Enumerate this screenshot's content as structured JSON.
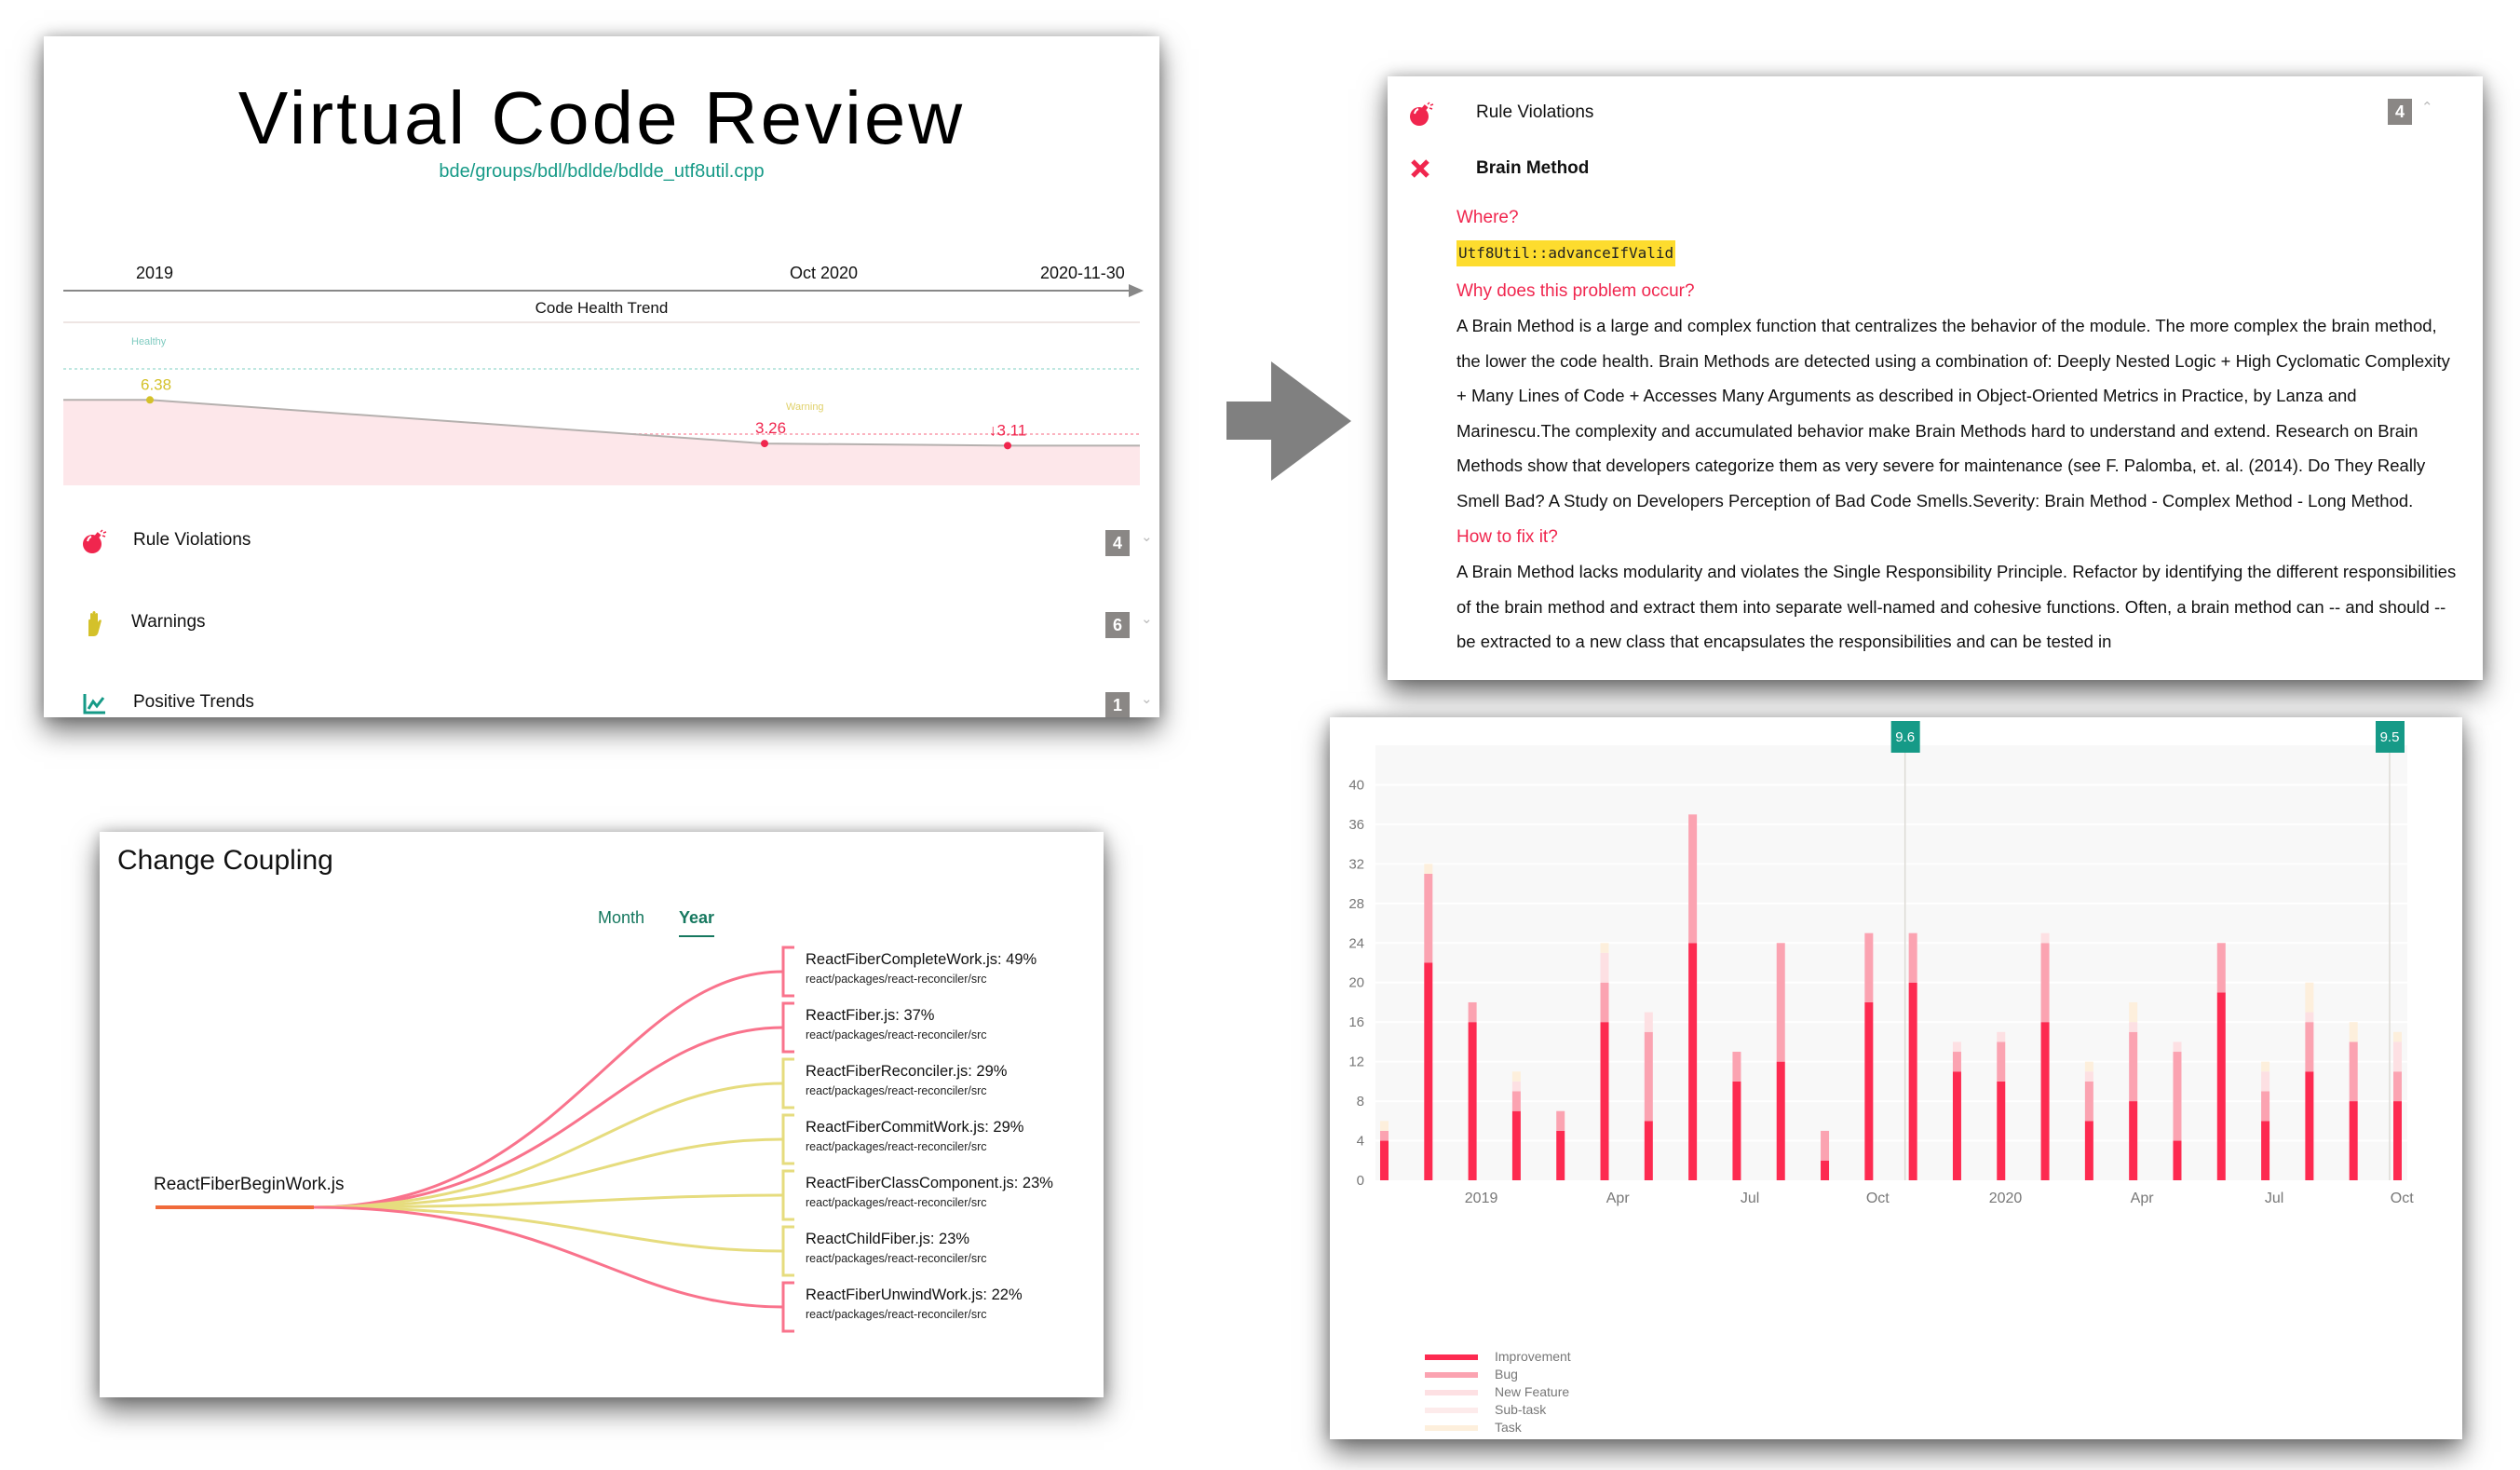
{
  "review": {
    "title": "Virtual Code Review",
    "file_path": "bde/groups/bdl/bdlde/bdlde_utf8util.cpp",
    "timeline_labels": [
      "2019",
      "Oct 2020",
      "2020-11-30"
    ],
    "health_chart": {
      "title": "Code Health Trend",
      "healthy_label": "Healthy",
      "warning_label": "Warning",
      "points": [
        {
          "label": "6.38",
          "value": 6.38,
          "status": "warning",
          "color": "#d4c12a"
        },
        {
          "label": "3.26",
          "value": 3.26,
          "status": "alert",
          "color": "#f0264e"
        },
        {
          "label": "↓3.11",
          "value": 3.11,
          "status": "alert",
          "color": "#f0264e"
        }
      ]
    },
    "issues": [
      {
        "label": "Rule Violations",
        "count": "4",
        "icon": "bomb-icon"
      },
      {
        "label": "Warnings",
        "count": "6",
        "icon": "hand-icon"
      },
      {
        "label": "Positive Trends",
        "count": "1",
        "icon": "trend-chart-icon"
      }
    ],
    "expand_glyph": "⌄"
  },
  "detail": {
    "header_label": "Rule Violations",
    "header_count": "4",
    "collapse_glyph": "⌃",
    "rule_name": "Brain Method",
    "where_heading": "Where?",
    "where_code": "Utf8Util::advanceIfValid",
    "why_heading": "Why does this problem occur?",
    "why_text": "A Brain Method is a large and complex function that centralizes the behavior of the module. The more complex the brain method, the lower the code health. Brain Methods are detected using a combination of: Deeply Nested Logic + High Cyclomatic Complexity + Many Lines of Code + Accesses Many Arguments as described in Object-Oriented Metrics in Practice, by Lanza and Marinescu.The complexity and accumulated behavior make Brain Methods hard to understand and extend. Research on Brain Methods show that developers categorize them as very severe for maintenance (see F. Palomba, et. al. (2014). Do They Really Smell Bad? A Study on Developers Perception of Bad Code Smells.Severity: Brain Method - Complex Method - Long Method.",
    "fix_heading": "How to fix it?",
    "fix_text": "A Brain Method lacks modularity and violates the Single Responsibility Principle. Refactor by identifying the different responsibilities of the brain method and extract them into separate well-named and cohesive functions. Often, a brain method can -- and should -- be extracted to a new class that encapsulates the responsibilities and can be tested in"
  },
  "coupling": {
    "title": "Change Coupling",
    "tabs": [
      {
        "label": "Month",
        "active": false
      },
      {
        "label": "Year",
        "active": true
      }
    ],
    "root": "ReactFiberBeginWork.js",
    "colors": {
      "high": "#f9738c",
      "medium": "#e6dc7e",
      "root": "#f06a3a"
    },
    "targets": [
      {
        "name": "ReactFiberCompleteWork.js: 49%",
        "path": "react/packages/react-reconciler/src",
        "level": "high"
      },
      {
        "name": "ReactFiber.js: 37%",
        "path": "react/packages/react-reconciler/src",
        "level": "high"
      },
      {
        "name": "ReactFiberReconciler.js: 29%",
        "path": "react/packages/react-reconciler/src",
        "level": "medium"
      },
      {
        "name": "ReactFiberCommitWork.js: 29%",
        "path": "react/packages/react-reconciler/src",
        "level": "medium"
      },
      {
        "name": "ReactFiberClassComponent.js: 23%",
        "path": "react/packages/react-reconciler/src",
        "level": "medium"
      },
      {
        "name": "ReactChildFiber.js: 23%",
        "path": "react/packages/react-reconciler/src",
        "level": "medium"
      },
      {
        "name": "ReactFiberUnwindWork.js: 22%",
        "path": "react/packages/react-reconciler/src",
        "level": "high"
      }
    ]
  },
  "chart_data": {
    "type": "bar",
    "stacked": true,
    "title": "",
    "xlabel": "",
    "ylabel": "",
    "ylim": [
      0,
      44
    ],
    "yticks": [
      0,
      4,
      8,
      12,
      16,
      20,
      24,
      28,
      32,
      36,
      40
    ],
    "grid": true,
    "legend_position": "bottom-left",
    "x_tick_labels": [
      {
        "label": "2019",
        "at_bar": 2.2
      },
      {
        "label": "Apr",
        "at_bar": 5.3
      },
      {
        "label": "Jul",
        "at_bar": 8.3
      },
      {
        "label": "Oct",
        "at_bar": 11.2
      },
      {
        "label": "2020",
        "at_bar": 14.1
      },
      {
        "label": "Apr",
        "at_bar": 17.2
      },
      {
        "label": "Jul",
        "at_bar": 20.2
      },
      {
        "label": "Oct",
        "at_bar": 23.1
      }
    ],
    "series": [
      {
        "name": "Improvement",
        "color": "#fd2a50",
        "values": [
          4,
          22,
          16,
          7,
          5,
          16,
          6,
          24,
          10,
          12,
          2,
          18,
          20,
          11,
          10,
          16,
          6,
          8,
          4,
          19,
          6,
          11,
          8,
          8
        ]
      },
      {
        "name": "Bug",
        "color": "#fba3b1",
        "values": [
          1,
          9,
          2,
          2,
          2,
          4,
          9,
          13,
          3,
          12,
          3,
          7,
          5,
          2,
          4,
          8,
          4,
          7,
          9,
          5,
          3,
          5,
          6,
          3
        ]
      },
      {
        "name": "New Feature",
        "color": "#fde0e3",
        "values": [
          0,
          0,
          0,
          1,
          0,
          3,
          2,
          0,
          0,
          0,
          0,
          0,
          0,
          1,
          1,
          1,
          1,
          1,
          1,
          0,
          2,
          1,
          0,
          3
        ]
      },
      {
        "name": "Sub-task",
        "color": "#fdebeb",
        "values": [
          0,
          0,
          0,
          0,
          0,
          0,
          0,
          0,
          0,
          0,
          0,
          0,
          0,
          0,
          0,
          0,
          0,
          0,
          0,
          0,
          0,
          0,
          0,
          0
        ]
      },
      {
        "name": "Task",
        "color": "#fdefdc",
        "values": [
          1,
          1,
          0,
          1,
          0,
          1,
          0,
          0,
          0,
          0,
          0,
          0,
          0,
          0,
          0,
          0,
          1,
          2,
          0,
          0,
          1,
          3,
          2,
          1
        ]
      }
    ],
    "annotations": [
      {
        "label": "9.6",
        "at_bar": 12,
        "color": "#169a87"
      },
      {
        "label": "9.5",
        "at_bar": 23,
        "color": "#169a87"
      }
    ]
  }
}
